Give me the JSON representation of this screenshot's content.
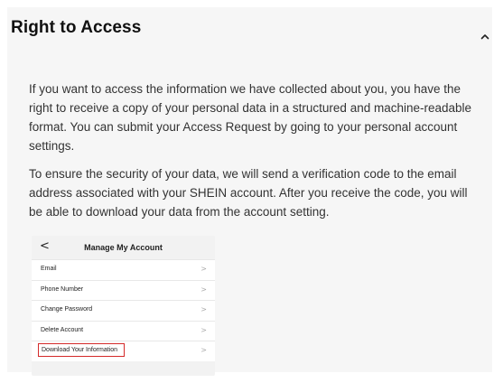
{
  "section": {
    "title": "Right to Access",
    "chevron_icon": "chevron-up-icon",
    "paragraphs": [
      "If you want to access the information we have collected about you, you have the right to receive a copy of your personal data in a structured and machine-readable format. You can submit your Access Request by going to your personal account settings.",
      "To ensure the security of your data, we will send a verification code to the email address associated with your SHEIN account. After you receive the code, you will be able to download your data from the account setting."
    ]
  },
  "mockup": {
    "back_icon": "chevron-left-icon",
    "back_glyph": "<",
    "title": "Manage My Account",
    "items": [
      {
        "label": "Email",
        "arrow": ">"
      },
      {
        "label": "Phone Number",
        "arrow": ">"
      },
      {
        "label": "Change Password",
        "arrow": ">"
      },
      {
        "label": "Delete Account",
        "arrow": ">"
      },
      {
        "label": "Download Your Information",
        "arrow": ">"
      }
    ],
    "highlight_color": "#d42a2a"
  }
}
